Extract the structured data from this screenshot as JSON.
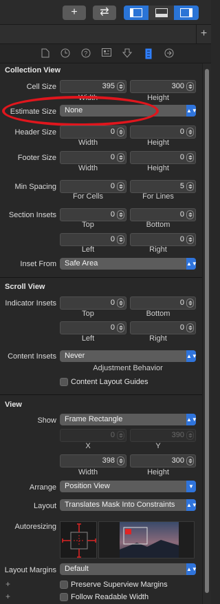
{
  "toolbar": {
    "add_label": "+",
    "swap_label": "⇄"
  },
  "tabbar": {
    "plus_label": "+"
  },
  "inspector_tabs": [
    "file-icon",
    "history-icon",
    "help-icon",
    "identity-icon",
    "attributes-icon",
    "size-icon",
    "connections-icon"
  ],
  "collection_view": {
    "title": "Collection View",
    "cell_size": {
      "label": "Cell Size",
      "width": "395",
      "height": "300",
      "width_label": "Width",
      "height_label": "Height"
    },
    "estimate_size": {
      "label": "Estimate Size",
      "value": "None"
    },
    "header_size": {
      "label": "Header Size",
      "width": "0",
      "height": "0",
      "width_label": "Width",
      "height_label": "Height"
    },
    "footer_size": {
      "label": "Footer Size",
      "width": "0",
      "height": "0",
      "width_label": "Width",
      "height_label": "Height"
    },
    "min_spacing": {
      "label": "Min Spacing",
      "cells": "0",
      "lines": "5",
      "cells_label": "For Cells",
      "lines_label": "For Lines"
    },
    "section_insets": {
      "label": "Section Insets",
      "top": "0",
      "bottom": "0",
      "left": "0",
      "right": "0",
      "top_label": "Top",
      "bottom_label": "Bottom",
      "left_label": "Left",
      "right_label": "Right"
    },
    "inset_from": {
      "label": "Inset From",
      "value": "Safe Area"
    }
  },
  "scroll_view": {
    "title": "Scroll View",
    "indicator_insets": {
      "label": "Indicator Insets",
      "top": "0",
      "bottom": "0",
      "left": "0",
      "right": "0",
      "top_label": "Top",
      "bottom_label": "Bottom",
      "left_label": "Left",
      "right_label": "Right"
    },
    "content_insets": {
      "label": "Content Insets",
      "value": "Never",
      "caption": "Adjustment Behavior"
    },
    "content_layout_guides": "Content Layout Guides"
  },
  "view": {
    "title": "View",
    "show": {
      "label": "Show",
      "value": "Frame Rectangle"
    },
    "origin": {
      "x": "0",
      "y": "390",
      "x_label": "X",
      "y_label": "Y"
    },
    "size": {
      "width": "398",
      "height": "300",
      "width_label": "Width",
      "height_label": "Height"
    },
    "arrange": {
      "label": "Arrange",
      "value": "Position View"
    },
    "layout": {
      "label": "Layout",
      "value": "Translates Mask Into Constraints"
    },
    "autoresizing": {
      "label": "Autoresizing"
    },
    "layout_margins": {
      "label": "Layout Margins",
      "value": "Default"
    },
    "preserve_superview_margins": "Preserve Superview Margins",
    "follow_readable_width": "Follow Readable Width"
  },
  "colors": {
    "accent": "#2f74dc",
    "annotation": "#e0161d"
  }
}
